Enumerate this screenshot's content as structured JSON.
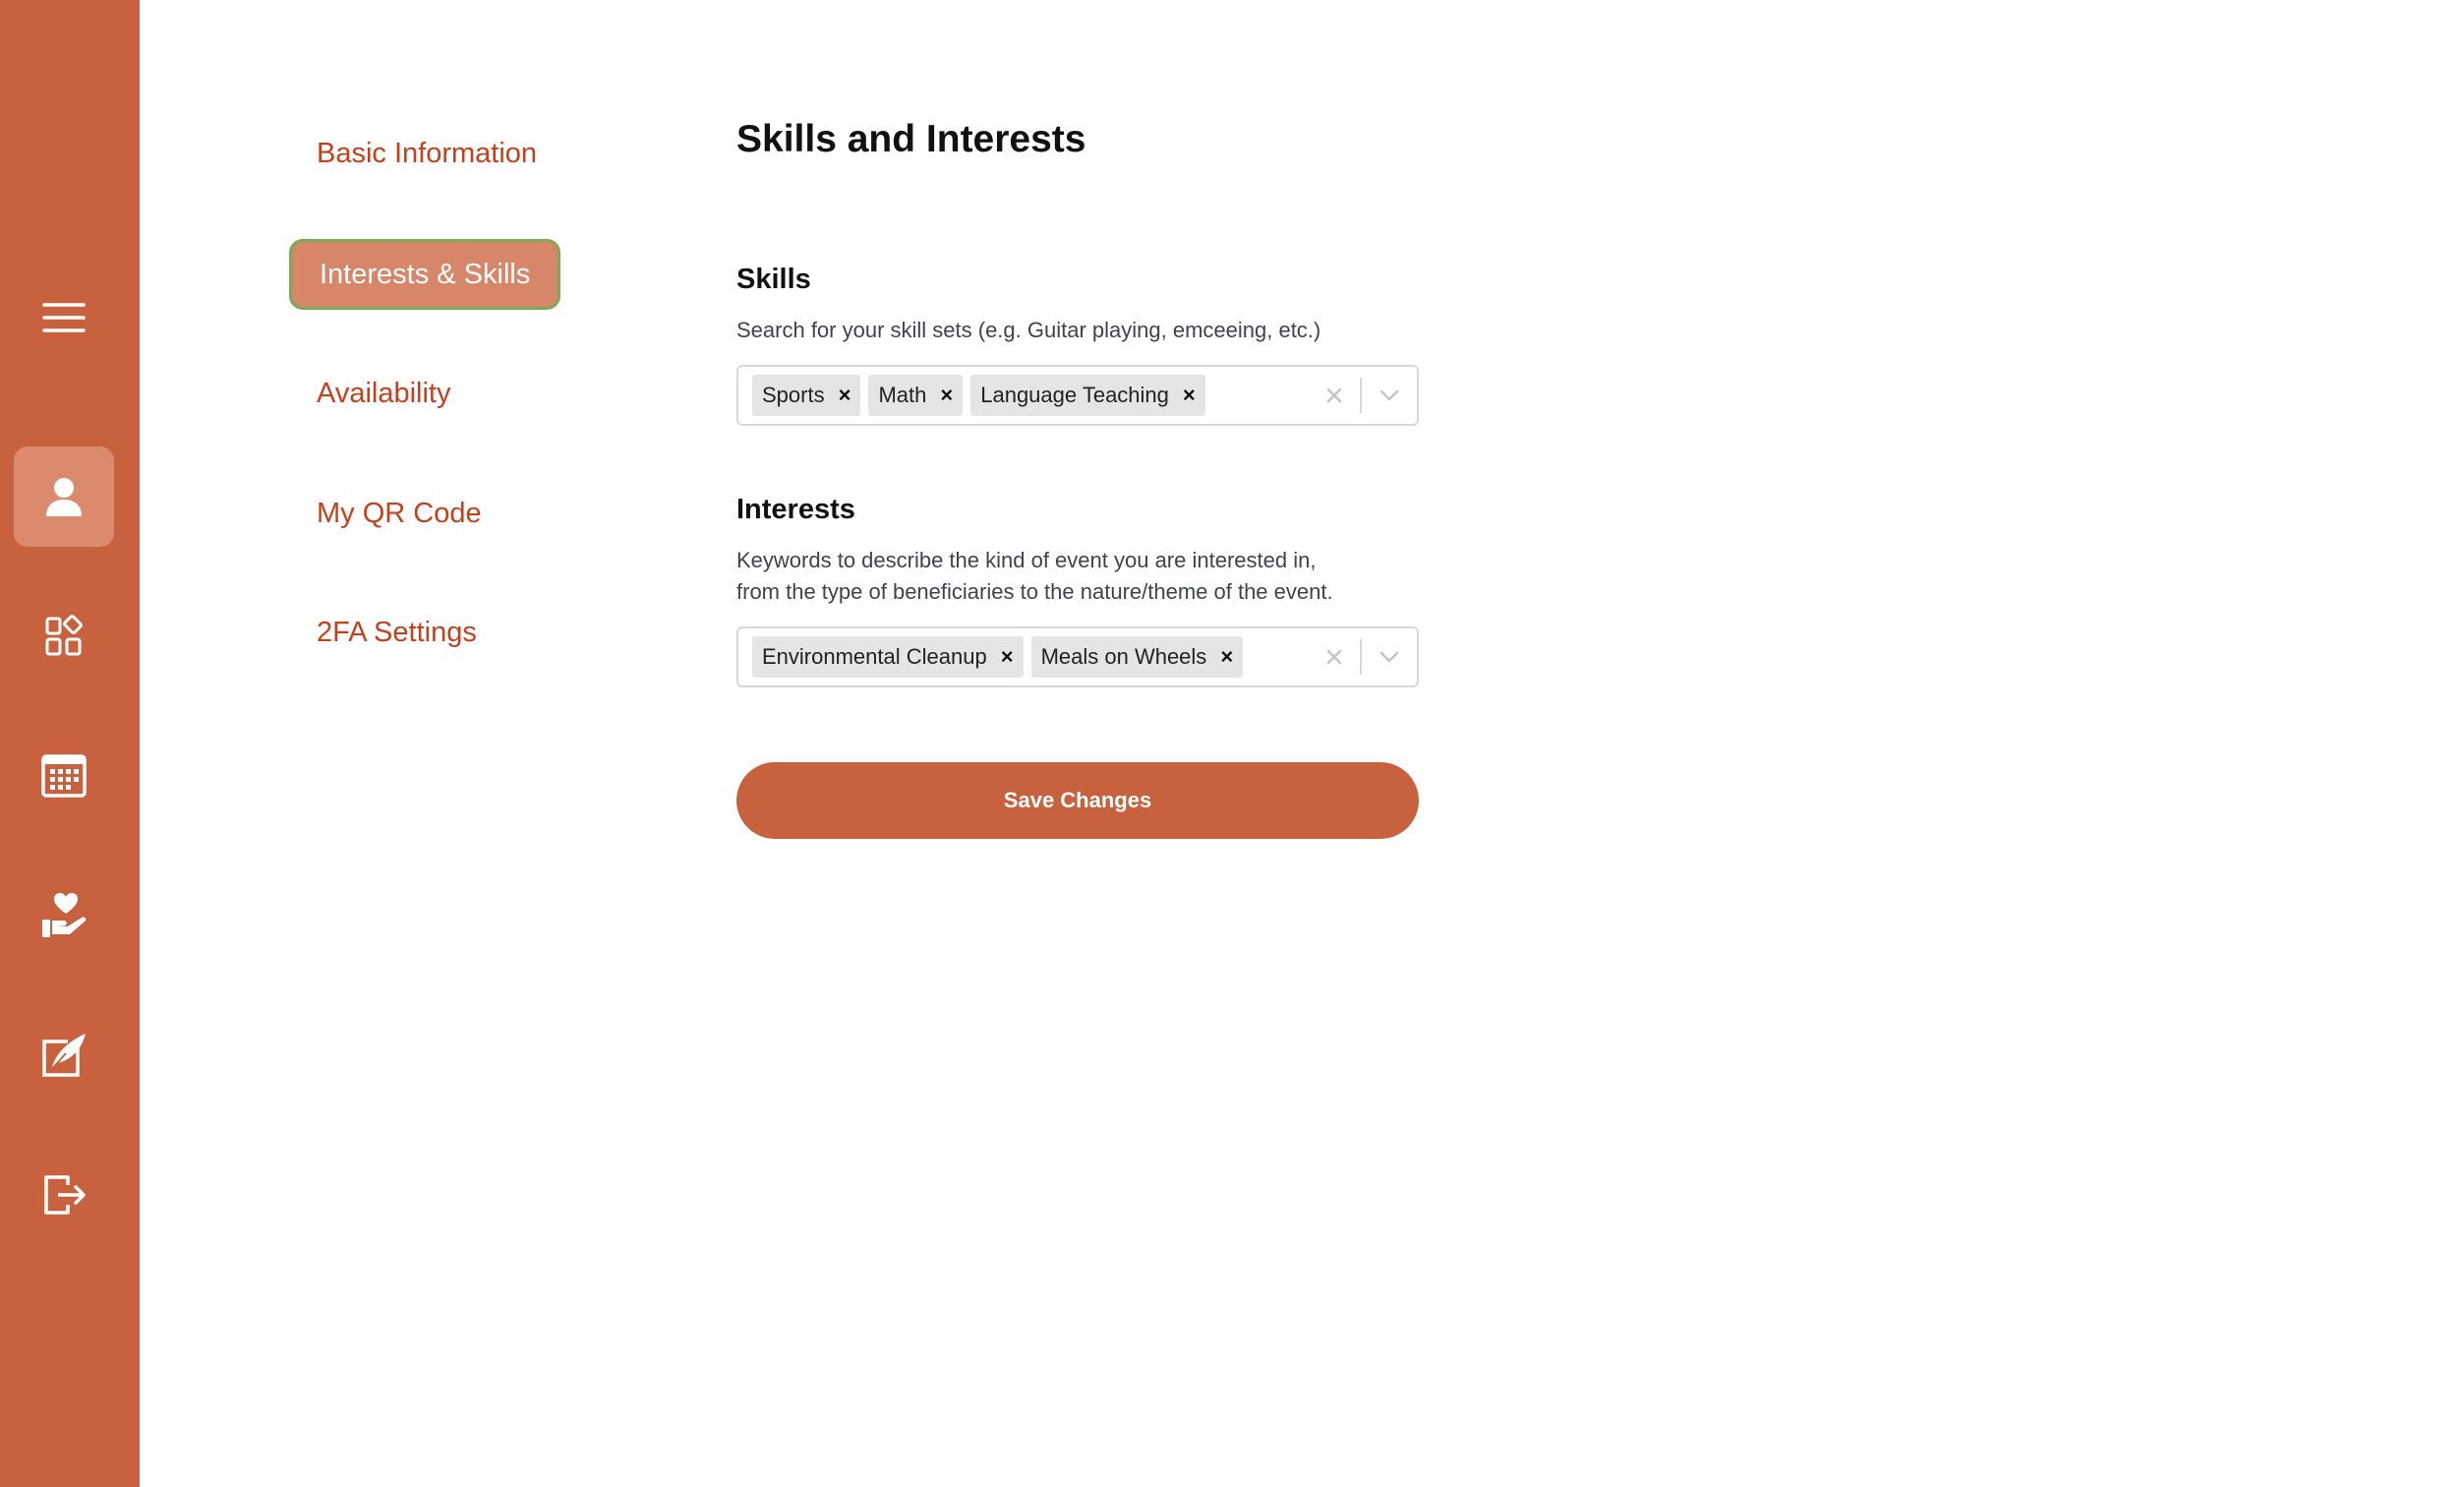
{
  "rail": {
    "items": [
      {
        "icon": "menu-icon"
      },
      {
        "icon": "user-icon",
        "active": true
      },
      {
        "icon": "dashboard-icon"
      },
      {
        "icon": "calendar-icon"
      },
      {
        "icon": "volunteer-hand-heart-icon"
      },
      {
        "icon": "edit-feather-icon"
      },
      {
        "icon": "logout-icon"
      }
    ],
    "color": "#c8613d",
    "active_color": "#dc8a6d"
  },
  "subnav": {
    "items": [
      {
        "label": "Basic Information"
      },
      {
        "label": "Interests & Skills",
        "active": true
      },
      {
        "label": "Availability"
      },
      {
        "label": "My QR Code"
      },
      {
        "label": "2FA Settings"
      }
    ]
  },
  "main": {
    "title": "Skills and Interests",
    "skills": {
      "title": "Skills",
      "help": "Search for your skill sets (e.g. Guitar playing, emceeing, etc.)",
      "selected": [
        "Sports",
        "Math",
        "Language Teaching"
      ],
      "remove_glyph": "×"
    },
    "interests": {
      "title": "Interests",
      "help_line1": "Keywords to describe the kind of event you are interested in,",
      "help_line2": "from the type of beneficiaries to the nature/theme of the event.",
      "selected": [
        "Environmental Cleanup",
        "Meals on Wheels"
      ],
      "remove_glyph": "×"
    },
    "save_label": "Save Changes"
  },
  "colors": {
    "accent": "#c8613d",
    "link": "#c4411c"
  }
}
